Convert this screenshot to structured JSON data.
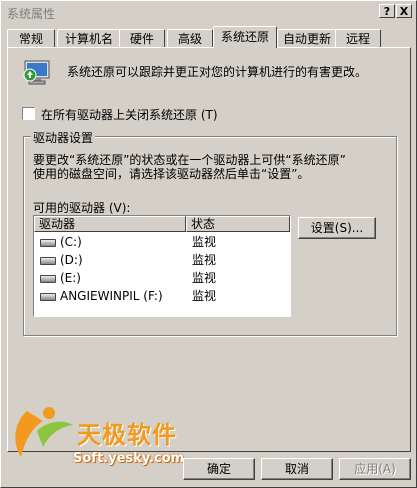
{
  "window": {
    "title": "系统属性"
  },
  "titlebar_buttons": {
    "help": "?",
    "close": "X"
  },
  "tabs": [
    {
      "label": "常规"
    },
    {
      "label": "计算机名"
    },
    {
      "label": "硬件"
    },
    {
      "label": "高级"
    },
    {
      "label": "系统还原",
      "active": true
    },
    {
      "label": "自动更新"
    },
    {
      "label": "远程"
    }
  ],
  "intro": {
    "text": "系统还原可以跟踪并更正对您的计算机进行的有害更改。",
    "icon": "system-restore-icon"
  },
  "checkbox": {
    "label": "在所有驱动器上关闭系统还原 (T)",
    "checked": false
  },
  "group": {
    "title": "驱动器设置",
    "desc_line1": "要更改“系统还原”的状态或在一个驱动器上可供“系统还原”",
    "desc_line2": "使用的磁盘空间，请选择该驱动器然后单击“设置”。",
    "list_label": "可用的驱动器 (V):",
    "columns": [
      "驱动器",
      "状态"
    ],
    "drives": [
      {
        "name": "(C:)",
        "status": "监视"
      },
      {
        "name": "(D:)",
        "status": "监视"
      },
      {
        "name": "(E:)",
        "status": "监视"
      },
      {
        "name": "ANGIEWINPIL (F:)",
        "status": "监视"
      }
    ],
    "settings_button": "设置(S)..."
  },
  "footer": {
    "ok": "确定",
    "cancel": "取消",
    "apply": "应用(A)"
  },
  "watermark": {
    "brand": "天极软件",
    "url": "Soft.yesky.com"
  },
  "colors": {
    "face": "#d4d0c8",
    "shadow": "#808080",
    "highlight": "#ffffff",
    "logo_orange": "#f39a1e",
    "logo_green": "#8cc63f"
  }
}
